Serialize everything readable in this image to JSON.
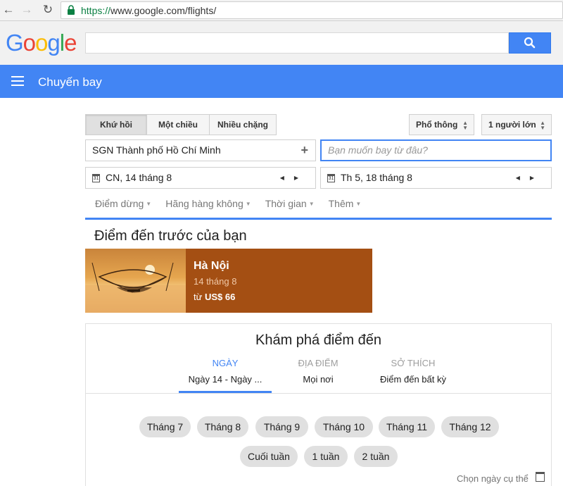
{
  "browser": {
    "url_scheme": "https://",
    "url_rest": "www.google.com/flights/",
    "back_icon": "arrow-left-icon",
    "forward_icon": "arrow-right-icon",
    "reload_icon": "reload-icon"
  },
  "header": {
    "logo_letters": [
      "G",
      "o",
      "o",
      "g",
      "l",
      "e"
    ],
    "logo_colors": [
      "#4285f4",
      "#ea4335",
      "#fbbc05",
      "#4285f4",
      "#34a853",
      "#ea4335"
    ],
    "search_value": "",
    "accent": "#4285f4"
  },
  "appbar": {
    "title": "Chuyến bay"
  },
  "form": {
    "trip_types": [
      "Khứ hồi",
      "Một chiều",
      "Nhiều chặng"
    ],
    "active_trip": "Khứ hồi",
    "cabin": "Phổ thông",
    "passengers": "1 người lớn",
    "origin": "SGN Thành phố Hồ Chí Minh",
    "destination_placeholder": "Bạn muốn bay từ đâu?",
    "depart_date": "CN, 14 tháng 8",
    "return_date": "Th 5, 18 tháng 8",
    "calendar_day": "31",
    "filters": [
      "Điểm dừng",
      "Hãng hàng không",
      "Thời gian",
      "Thêm"
    ]
  },
  "previous": {
    "title": "Điểm đến trước của bạn",
    "card": {
      "city": "Hà Nội",
      "date": "14 tháng 8",
      "price_prefix": "từ",
      "price": "US$ 66"
    }
  },
  "explore": {
    "title": "Khám phá điểm đến",
    "tabs": [
      {
        "label": "NGÀY",
        "value": "Ngày 14 - Ngày ..."
      },
      {
        "label": "ĐỊA ĐIỂM",
        "value": "Mọi nơi"
      },
      {
        "label": "SỞ THÍCH",
        "value": "Điểm đến bất kỳ"
      }
    ],
    "months": [
      "Tháng 7",
      "Tháng 8",
      "Tháng 9",
      "Tháng 10",
      "Tháng 11",
      "Tháng 12"
    ],
    "durations": [
      "Cuối tuần",
      "1 tuần",
      "2 tuần"
    ],
    "pick_date": "Chọn ngày cụ thể"
  }
}
